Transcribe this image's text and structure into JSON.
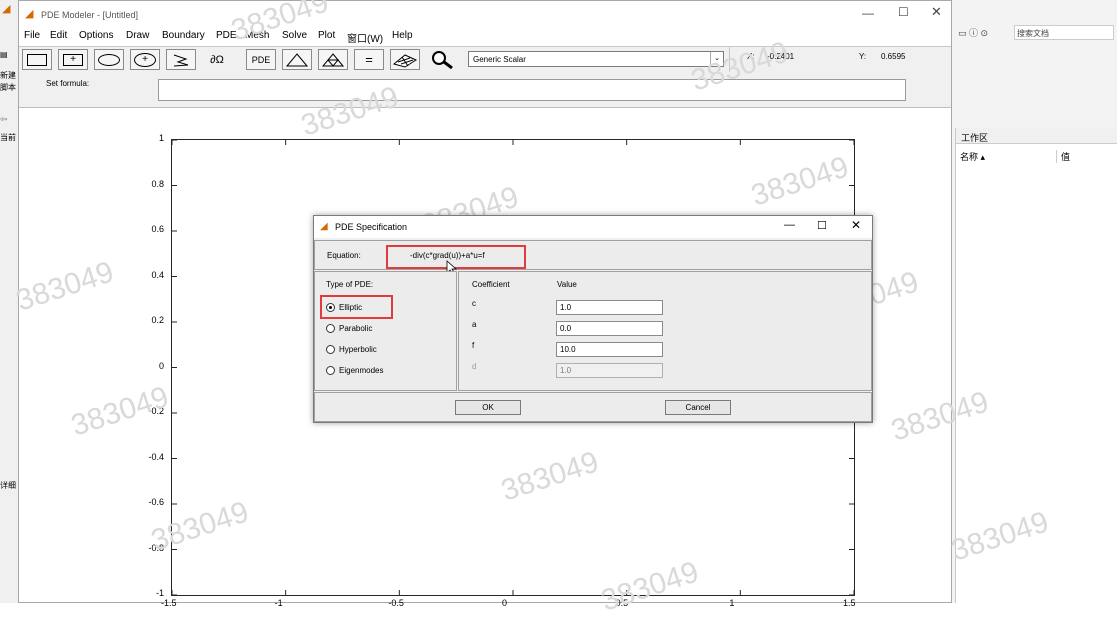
{
  "app": {
    "title": "PDE Modeler - [Untitled]"
  },
  "menu": [
    "File",
    "Edit",
    "Options",
    "Draw",
    "Boundary",
    "PDE",
    "Mesh",
    "Solve",
    "Plot",
    "窗口(W)",
    "Help"
  ],
  "toolbar": {
    "buttons": [
      {
        "label": "",
        "icon": "rectangle-icon"
      },
      {
        "label": "+",
        "icon": "rectangle-center-icon"
      },
      {
        "label": "",
        "icon": "ellipse-icon"
      },
      {
        "label": "+",
        "icon": "ellipse-center-icon"
      },
      {
        "label": "",
        "icon": "polygon-icon"
      },
      {
        "label": "∂Ω",
        "icon": "boundary-mode-icon"
      },
      {
        "label": "PDE",
        "icon": "pde-mode-icon"
      },
      {
        "label": "",
        "icon": "triangle-mesh-icon"
      },
      {
        "label": "",
        "icon": "refine-mesh-icon"
      },
      {
        "label": "=",
        "icon": "solve-icon"
      },
      {
        "label": "",
        "icon": "plot-3d-icon"
      },
      {
        "label": "",
        "icon": "zoom-icon"
      }
    ],
    "app_mode": "Generic Scalar",
    "x_label": "X:",
    "x_value": "-0.2401",
    "y_label": "Y:",
    "y_value": "0.6595"
  },
  "formula": {
    "label": "Set formula:",
    "value": ""
  },
  "plot": {
    "y_ticks": [
      "1",
      "0.8",
      "0.6",
      "0.4",
      "0.2",
      "0",
      "-0.2",
      "-0.4",
      "-0.6",
      "-0.8",
      "-1"
    ],
    "x_ticks": [
      "-1.5",
      "-1",
      "-0.5",
      "0",
      "0.5",
      "1",
      "1.5"
    ]
  },
  "background": {
    "left_labels": [
      "新建",
      "脚本",
      "当前"
    ],
    "right_search": "搜索文档",
    "workspace_title": "工作区",
    "col_name": "名称 ▴",
    "col_value": "值",
    "bottom_label": "详细"
  },
  "watermark": "383049",
  "dialog": {
    "title": "PDE Specification",
    "equation_label": "Equation:",
    "equation": "-div(c*grad(u))+a*u=f",
    "type_header": "Type of PDE:",
    "types": [
      {
        "label": "Elliptic",
        "selected": true
      },
      {
        "label": "Parabolic",
        "selected": false
      },
      {
        "label": "Hyperbolic",
        "selected": false
      },
      {
        "label": "Eigenmodes",
        "selected": false
      }
    ],
    "coef_header": "Coefficient",
    "value_header": "Value",
    "coefficients": [
      {
        "name": "c",
        "value": "1.0",
        "enabled": true
      },
      {
        "name": "a",
        "value": "0.0",
        "enabled": true
      },
      {
        "name": "f",
        "value": "10.0",
        "enabled": true
      },
      {
        "name": "d",
        "value": "1.0",
        "enabled": false
      }
    ],
    "ok": "OK",
    "cancel": "Cancel"
  },
  "colors": {
    "highlight": "#e23b3b",
    "accent": "#0078d7"
  }
}
